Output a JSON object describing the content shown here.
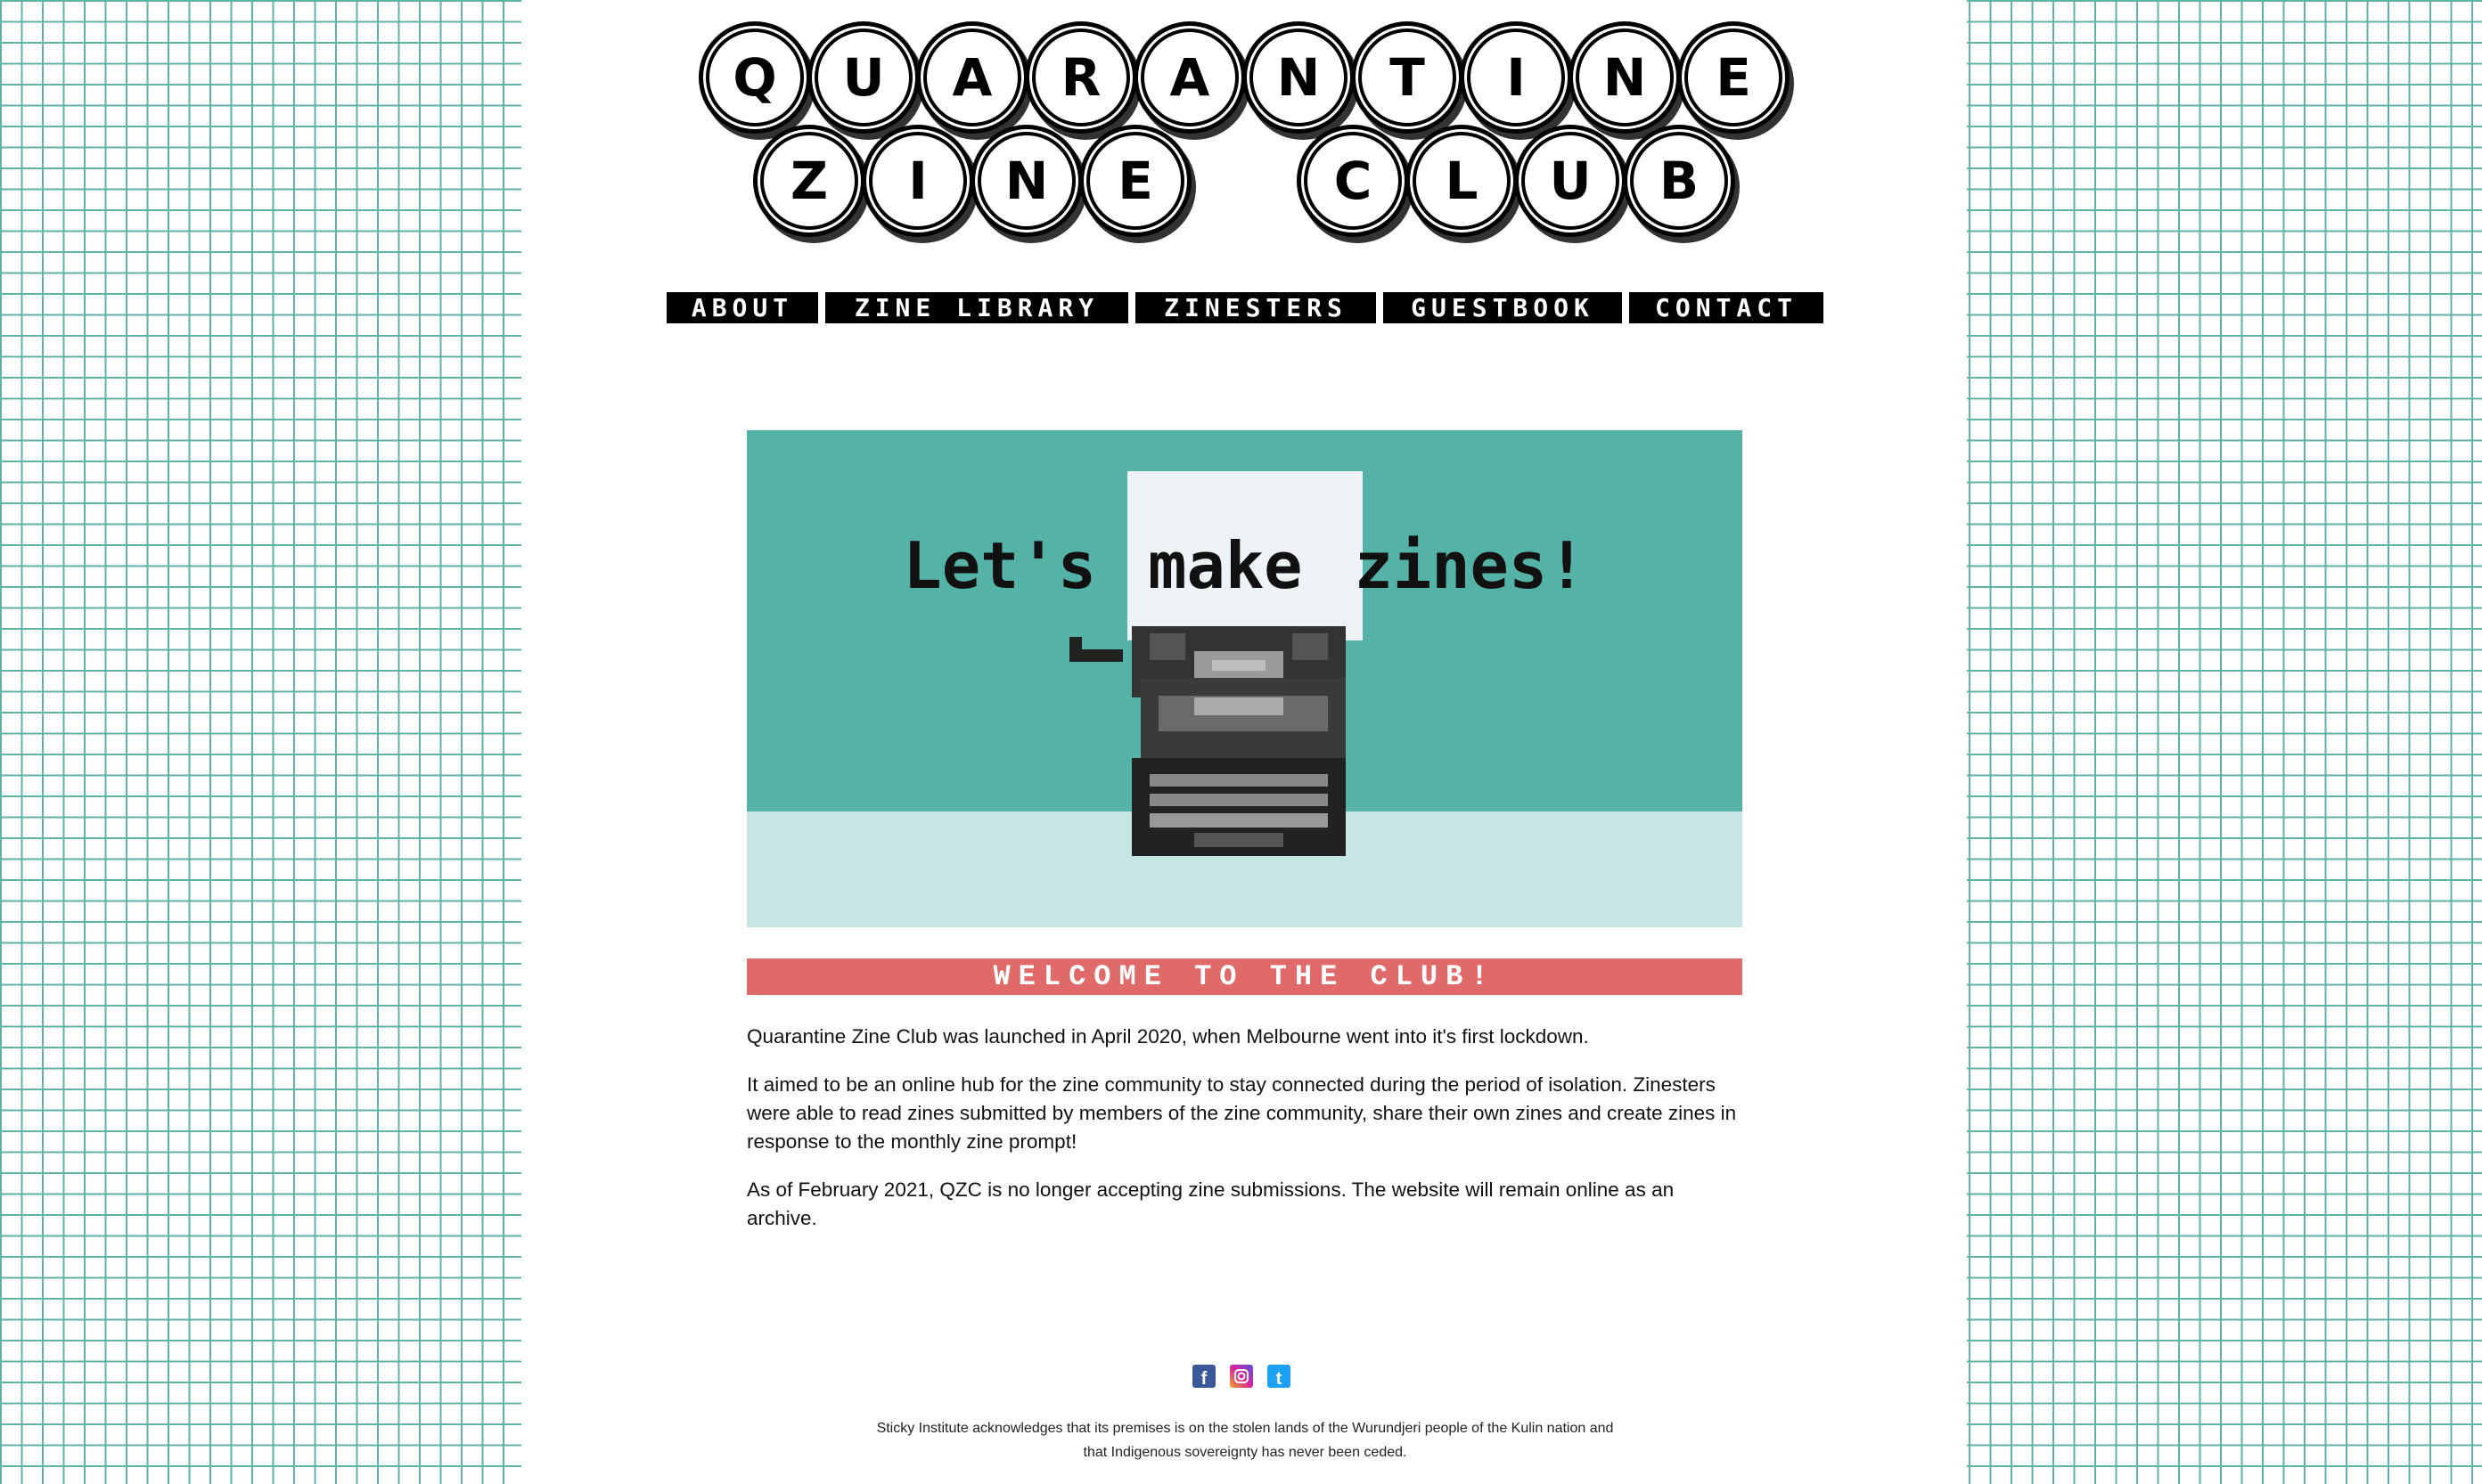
{
  "logo": {
    "row1": [
      "Q",
      "U",
      "A",
      "R",
      "A",
      "N",
      "T",
      "I",
      "N",
      "E"
    ],
    "row2": [
      "Z",
      "I",
      "N",
      "E",
      " ",
      "C",
      "L",
      "U",
      "B"
    ]
  },
  "nav": [
    {
      "label": "ABOUT"
    },
    {
      "label": "ZINE LIBRARY"
    },
    {
      "label": "ZINESTERS"
    },
    {
      "label": "GUESTBOOK"
    },
    {
      "label": "CONTACT"
    }
  ],
  "hero": {
    "word1": "Let's",
    "word2": "make",
    "word3": "zines!",
    "colors": {
      "sky": "#55b2a7",
      "floor": "#c6e6e4",
      "paper": "#eef3f6"
    }
  },
  "welcome": "WELCOME TO THE CLUB!",
  "content": {
    "p1": "Quarantine Zine Club was launched in April 2020, when Melbourne went into it's first lockdown.",
    "p2": "It aimed to be an online hub for the zine community to stay connected during the period of isolation. Zinesters were able to read zines submitted by members of the zine community, share their own zines and create zines in response to the monthly zine prompt!",
    "p3": "As of February 2021, QZC is no longer accepting zine submissions. The website will remain online as an archive."
  },
  "social": {
    "icons": [
      "facebook-icon",
      "instagram-icon",
      "twitter-icon"
    ],
    "facebook": "f",
    "twitter": "t"
  },
  "ack": "Sticky Institute acknowledges that its premises is on the stolen lands of the Wurundjeri people of the Kulin nation and that Indigenous sovereignty has never been ceded.",
  "colors": {
    "grid": "#5fb3a5",
    "banner": "#e06a6a"
  }
}
